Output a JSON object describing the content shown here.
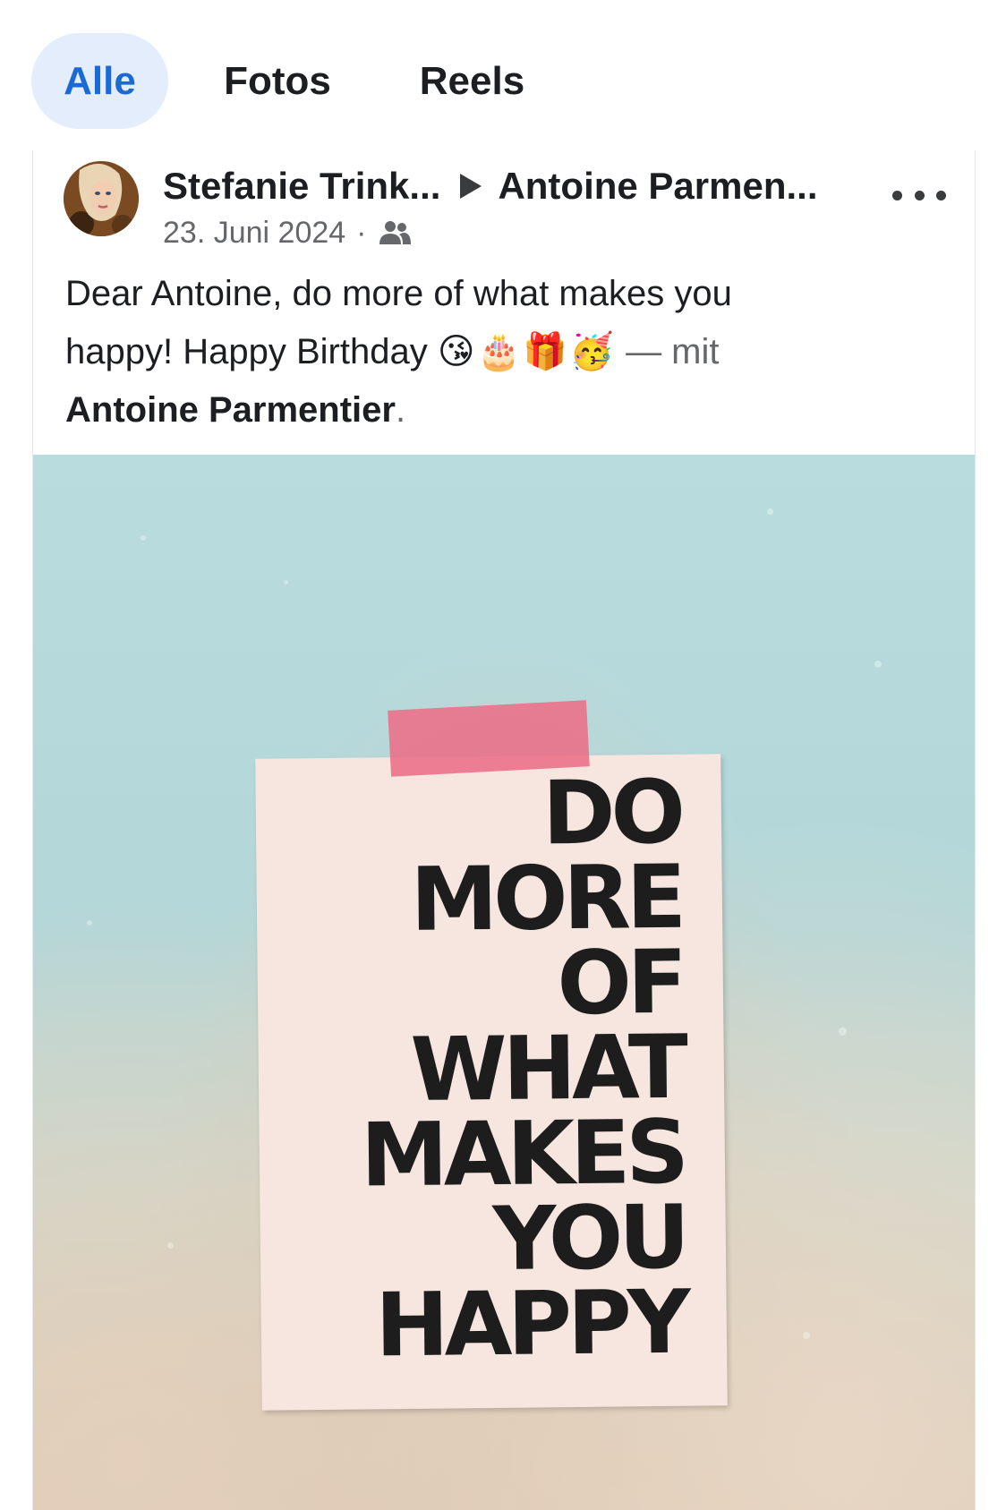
{
  "tabs": [
    {
      "label": "Alle",
      "active": true
    },
    {
      "label": "Fotos",
      "active": false
    },
    {
      "label": "Reels",
      "active": false
    }
  ],
  "post": {
    "author": "Stefanie Trink...",
    "recipient": "Antoine Parmen...",
    "date": "23. Juni 2024",
    "separator": "·",
    "audience_icon": "friends-icon",
    "more_icon": "more-options-icon",
    "text_line1": "Dear Antoine, do more of what makes you",
    "text_line2": "happy! Happy Birthday",
    "emojis": "😘🎂🎁🥳",
    "with_text": "— mit",
    "tagged_person": "Antoine Parmentier",
    "period": "."
  },
  "photo": {
    "poster_lines": [
      "DO",
      "MORE",
      "OF",
      "WHAT",
      "MAKES",
      "YOU",
      "HAPPY"
    ]
  },
  "colors": {
    "accent": "#1a6ad6",
    "active_tab_bg": "#e3edfc",
    "secondary_text": "#65676b",
    "primary_text": "#1c1e21"
  }
}
